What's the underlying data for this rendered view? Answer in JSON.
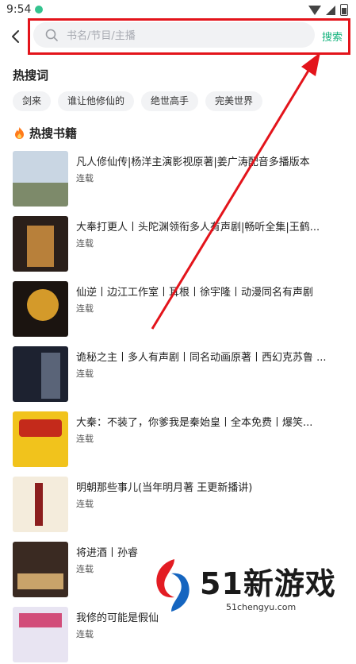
{
  "status_bar": {
    "time": "9:54"
  },
  "search": {
    "placeholder": "书名/节目/主播",
    "button_label": "搜索"
  },
  "hot_words": {
    "title": "热搜词",
    "tags": [
      "剑来",
      "谁让他修仙的",
      "绝世高手",
      "完美世界"
    ]
  },
  "hot_books": {
    "title": "热搜书籍",
    "items": [
      {
        "title": "凡人修仙传|杨洋主演影视原著|姜广涛配音多播版本",
        "status": "连载",
        "cover_colors": [
          "#c9d6e3",
          "#7d8a6a"
        ]
      },
      {
        "title": "大奉打更人丨头陀渊领衔多人有声剧|畅听全集|王鹤...",
        "status": "连载",
        "cover_colors": [
          "#2a1f1a",
          "#b8803a"
        ]
      },
      {
        "title": "仙逆丨边江工作室丨耳根丨徐宇隆丨动漫同名有声剧",
        "status": "连载",
        "cover_colors": [
          "#1b1410",
          "#d49a2a"
        ]
      },
      {
        "title": "诡秘之主丨多人有声剧丨同名动画原著丨西幻克苏鲁 ...",
        "status": "连载",
        "cover_colors": [
          "#1d2230",
          "#5a6478"
        ]
      },
      {
        "title": "大秦：不装了，你爹我是秦始皇丨全本免费丨爆笑...",
        "status": "连载",
        "cover_colors": [
          "#f1c31c",
          "#c42a1b"
        ]
      },
      {
        "title": "明朝那些事儿(当年明月著 王更新播讲)",
        "status": "连载",
        "cover_colors": [
          "#f4ecdc",
          "#8b1e1e"
        ]
      },
      {
        "title": "将进酒丨孙睿",
        "status": "连载",
        "cover_colors": [
          "#3a2a22",
          "#c9a36a"
        ]
      },
      {
        "title": "我修的可能是假仙",
        "status": "连载",
        "cover_colors": [
          "#e8e4f2",
          "#d24d7a"
        ]
      }
    ]
  },
  "watermark": {
    "brand": "51新游戏",
    "url": "51chengyu.com"
  },
  "colors": {
    "accent": "#16b37e",
    "highlight_box": "#e3141b"
  }
}
